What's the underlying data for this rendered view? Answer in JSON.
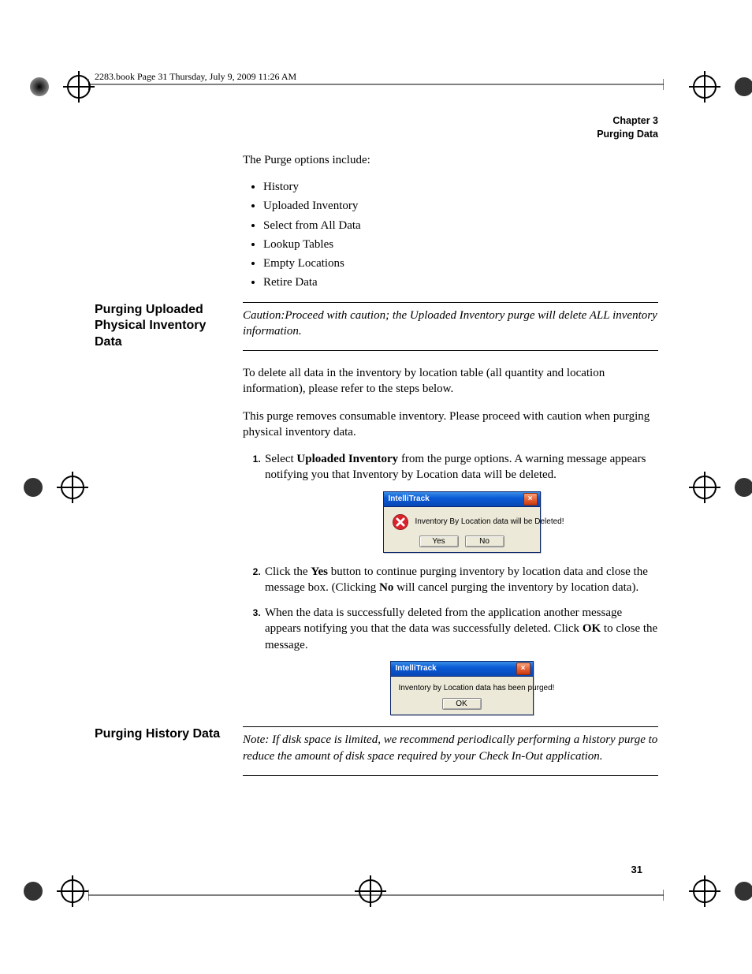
{
  "headerLine": "2283.book  Page 31  Thursday, July 9, 2009  11:26 AM",
  "chapter": {
    "line1": "Chapter 3",
    "line2": "Purging Data"
  },
  "intro": "The Purge options include:",
  "options": [
    "History",
    "Uploaded Inventory",
    "Select from All Data",
    "Lookup Tables",
    "Empty Locations",
    "Retire Data"
  ],
  "section1": {
    "title": "Purging Uploaded Physical Inventory Data",
    "caution": "Caution:Proceed with caution; the Uploaded Inventory purge will delete ALL inventory information.",
    "p1": "To delete all data in the inventory by location table (all quantity and location information), please refer to the steps below.",
    "p2": "This purge removes consumable inventory. Please proceed with caution when purging physical inventory data.",
    "step1a": "Select ",
    "step1bold": "Uploaded Inventory",
    "step1b": " from the purge options. A warning message appears notifying you that Inventory by Location data will be deleted.",
    "step2a": "Click the ",
    "step2yes": "Yes",
    "step2b": " button to continue purging inventory by location data and close the message box. (Clicking ",
    "step2no": "No",
    "step2c": " will cancel purging the inventory by location data).",
    "step3a": "When the data is successfully deleted from the application another message appears notifying you that the data was successfully deleted. Click ",
    "step3ok": "OK",
    "step3b": " to close the message."
  },
  "dialog1": {
    "title": "IntelliTrack",
    "msg": "Inventory By Location data will be Deleted!",
    "yes": "Yes",
    "no": "No"
  },
  "dialog2": {
    "title": "IntelliTrack",
    "msg": "Inventory by Location data has been purged!",
    "ok": "OK"
  },
  "section2": {
    "title": "Purging History Data",
    "note": "Note:   If disk space is limited, we recommend periodically performing a history purge to reduce the amount of disk space required by your Check In-Out application."
  },
  "pageNum": "31"
}
